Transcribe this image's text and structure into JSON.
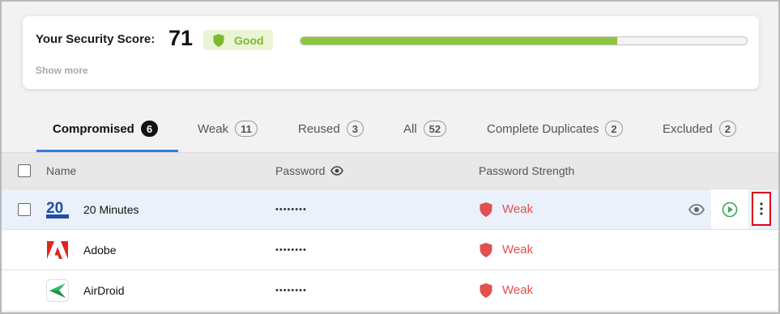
{
  "score": {
    "label": "Your Security Score:",
    "value": "71",
    "badge": "Good",
    "progress_fraction": 0.71,
    "show_more": "Show more",
    "colors": {
      "good_text": "#7cba2d",
      "progress_fill": "#8cc63f"
    }
  },
  "tabs": [
    {
      "label": "Compromised",
      "count": "6",
      "active": true
    },
    {
      "label": "Weak",
      "count": "11"
    },
    {
      "label": "Reused",
      "count": "3"
    },
    {
      "label": "All",
      "count": "52"
    },
    {
      "label": "Complete Duplicates",
      "count": "2"
    },
    {
      "label": "Excluded",
      "count": "2"
    }
  ],
  "table": {
    "headers": {
      "name": "Name",
      "password": "Password",
      "strength": "Password Strength"
    },
    "rows": [
      {
        "name": "20 Minutes",
        "password": "••••••••",
        "strength": "Weak",
        "logo": "20-minutes-logo",
        "selected": true
      },
      {
        "name": "Adobe",
        "password": "••••••••",
        "strength": "Weak",
        "logo": "adobe-logo"
      },
      {
        "name": "AirDroid",
        "password": "••••••••",
        "strength": "Weak",
        "logo": "airdroid-logo"
      }
    ]
  },
  "colors": {
    "accent": "#2f80d1",
    "weak": "#e05050",
    "highlight": "#e0001a"
  },
  "icons": [
    "shield-icon",
    "eye-icon",
    "play-circle-icon",
    "kebab-menu-icon",
    "weak-shield-icon"
  ]
}
